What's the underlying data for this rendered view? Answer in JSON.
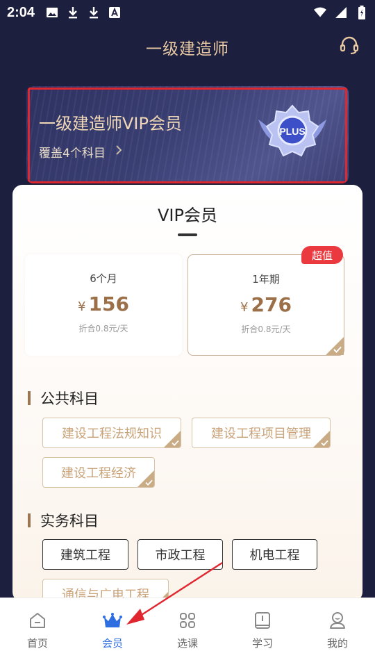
{
  "status_bar": {
    "time": "2:04"
  },
  "header": {
    "title": "一级建造师"
  },
  "banner": {
    "title": "一级建造师VIP会员",
    "subtitle": "覆盖4个科目",
    "badge_text": "PLUS"
  },
  "card": {
    "title": "VIP会员",
    "plans": [
      {
        "name": "6个月",
        "currency": "¥",
        "price": "156",
        "note": "折合0.8元/天",
        "selected": false
      },
      {
        "name": "1年期",
        "currency": "¥",
        "price": "276",
        "note": "折合0.8元/天",
        "selected": true,
        "tag": "超值"
      }
    ],
    "public_section": {
      "title": "公共科目",
      "items": [
        {
          "label": "建设工程法规知识",
          "selected": true
        },
        {
          "label": "建设工程项目管理",
          "selected": true
        },
        {
          "label": "建设工程经济",
          "selected": true
        }
      ]
    },
    "practice_section": {
      "title": "实务科目",
      "items": [
        {
          "label": "建筑工程",
          "selected": false
        },
        {
          "label": "市政工程",
          "selected": false
        },
        {
          "label": "机电工程",
          "selected": false
        },
        {
          "label": "通信与广电工程",
          "selected": true
        }
      ]
    }
  },
  "tabbar": {
    "items": [
      {
        "label": "首页",
        "icon": "home-icon",
        "active": false
      },
      {
        "label": "会员",
        "icon": "crown-icon",
        "active": true
      },
      {
        "label": "选课",
        "icon": "grid-icon",
        "active": false
      },
      {
        "label": "学习",
        "icon": "book-icon",
        "active": false
      },
      {
        "label": "我的",
        "icon": "user-icon",
        "active": false
      }
    ]
  },
  "colors": {
    "background": "#1c1f3e",
    "gold_text": "#e9c9a2",
    "price": "#9b6f48",
    "tag_red": "#ea3a3f",
    "active_tab": "#2f6ee0",
    "annotation_red": "#e0262f"
  }
}
